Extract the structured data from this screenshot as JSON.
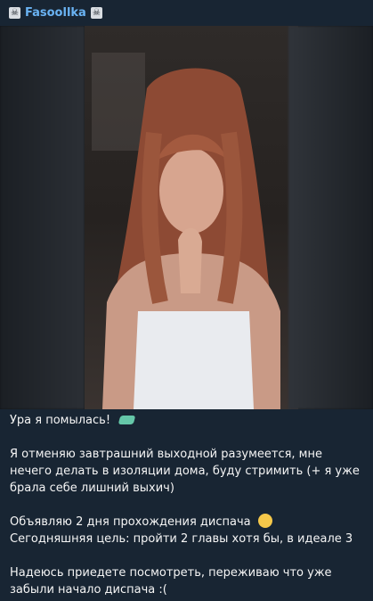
{
  "header": {
    "channel_name": "Fasoollka"
  },
  "caption": {
    "line1": "Ура я помылась!",
    "para2": "Я отменяю завтрашний выходной разумеется, мне нечего делать в изоляции дома, буду стримить (+ я уже брала себе лишний выхич)",
    "para3_line1": "Объявляю 2 дня прохождения диспача",
    "para3_line2": "Сегодняшняя цель: пройти 2 главы хотя бы, в идеале 3",
    "para4": "Надеюсь приедете посмотреть, переживаю что уже забыли начало диспача :("
  },
  "icons": {
    "badge_left": "pirate-flag-icon",
    "badge_right": "pirate-flag-icon",
    "emoji1": "soap-emoji-icon",
    "emoji2": "wink-emoji-icon"
  },
  "colors": {
    "background": "#182533",
    "channel_name": "#6ab3f3",
    "text": "#f5f5f5"
  }
}
